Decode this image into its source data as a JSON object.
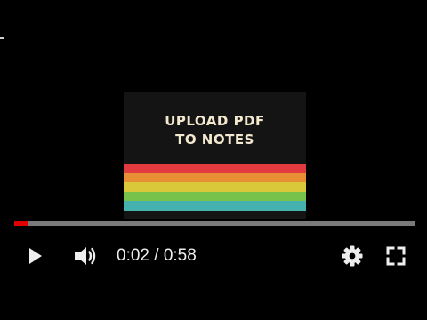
{
  "player": {
    "video_title": "UPLOAD PDF\nTO NOTES",
    "stripe_colors": [
      "#e23b3f",
      "#e88e34",
      "#d9c93a",
      "#76c24b",
      "#46b2b0"
    ],
    "progress": {
      "fraction": 0.0345,
      "played_color": "#e00000",
      "track_color": "#7a7a7a"
    },
    "controls": {
      "play_icon": "play-icon",
      "volume_icon": "volume-icon",
      "time": {
        "current": "0:02",
        "separator": " / ",
        "duration": "0:58"
      },
      "settings_icon": "gear-icon",
      "fullscreen_icon": "fullscreen-icon"
    }
  }
}
